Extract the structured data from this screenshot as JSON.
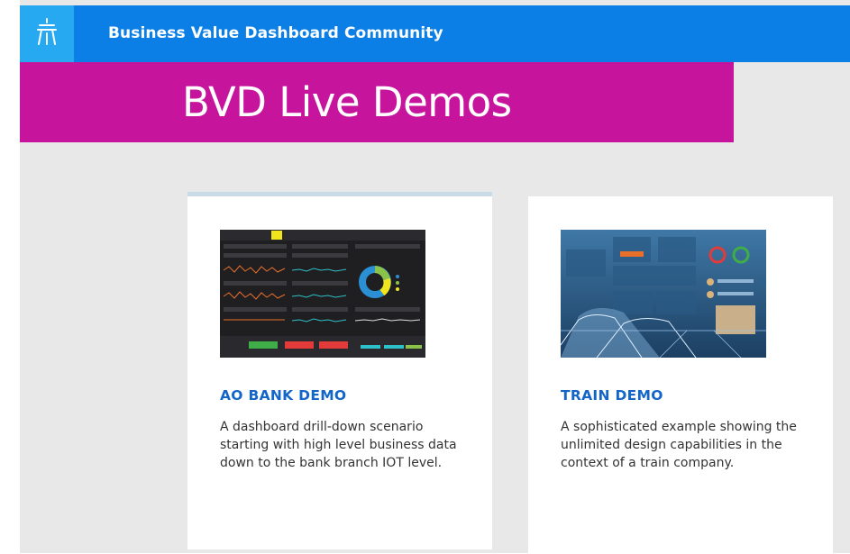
{
  "header": {
    "title": "Business Value Dashboard Community",
    "logo_icon": "lighthouse-icon"
  },
  "banner": {
    "title": "BVD Live Demos"
  },
  "demos": [
    {
      "title": "AO BANK DEMO",
      "description": "A dashboard drill-down scenario starting with high level business data down to the bank branch IOT level.",
      "thumbnail": "bank-dashboard-thumbnail"
    },
    {
      "title": "TRAIN DEMO",
      "description": "A sophisticated example showing the unlimited design capabilities in the context of a train company.",
      "thumbnail": "train-dashboard-thumbnail"
    }
  ],
  "colors": {
    "header": "#0b7fe6",
    "logo_bg": "#26a9f1",
    "banner": "#c7149c",
    "card_title": "#1366c8"
  }
}
